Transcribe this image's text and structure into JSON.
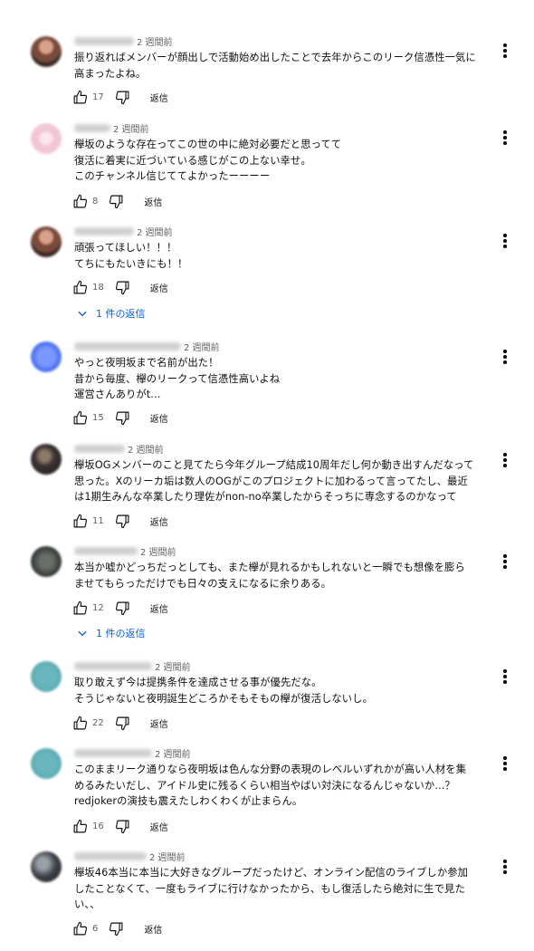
{
  "comments": [
    {
      "avatar": "av-brown",
      "time": "2 週間前",
      "text": "振り返ればメンバーが顔出しで活動始め出したことで去年からこのリーク信憑性一気に\n高まったよね。",
      "likes": "17",
      "reply_label": "返信",
      "replies": ""
    },
    {
      "avatar": "av-pink",
      "time": "2 週間前",
      "text": "欅坂のような存在ってこの世の中に絶対必要だと思ってて\n復活に着実に近づいている感じがこの上ない幸せ。\nこのチャンネル信じててよかったーーーー",
      "likes": "8",
      "reply_label": "返信",
      "replies": ""
    },
    {
      "avatar": "av-brown",
      "time": "2 週間前",
      "text": "頑張ってほしい！！！\nてちにもたいきにも！！",
      "likes": "18",
      "reply_label": "返信",
      "replies": "1 件の返信"
    },
    {
      "avatar": "av-blue",
      "time": "2 週間前",
      "text": "やっと夜明坂まで名前が出た！\n昔から毎度、欅のリークって信憑性高いよね\n運営さんありがt...",
      "likes": "15",
      "reply_label": "返信",
      "replies": ""
    },
    {
      "avatar": "av-dark",
      "time": "2 週間前",
      "text": "欅坂OGメンバーのこと見てたら今年グループ結成10周年だし何か動き出すんだなって\n思った。Xのリーカ垢は数人のOGがこのプロジェクトに加わるって言ってたし、最近\nは1期生みんな卒業したり理佐がnon-no卒業したからそっちに専念するのかなって",
      "likes": "11",
      "reply_label": "返信",
      "replies": ""
    },
    {
      "avatar": "av-grey",
      "time": "2 週間前",
      "text": "本当か嘘かどっちだっとしても、また欅が見れるかもしれないと一瞬でも想像を膨ら\nませてもらっただけでも日々の支えになるに余りある。",
      "likes": "12",
      "reply_label": "返信",
      "replies": "1 件の返信"
    },
    {
      "avatar": "av-teal",
      "time": "2 週間前",
      "text": "取り敢えず今は提携条件を達成させる事が優先だな。\nそうじゃないと夜明誕生どころかそもそもの欅が復活しないし。",
      "likes": "22",
      "reply_label": "返信",
      "replies": ""
    },
    {
      "avatar": "av-teal",
      "time": "2 週間前",
      "text": "このままリーク通りなら夜明坂は色んな分野の表現のレベルいずれかが高い人材を集\nめるみたいだし、アイドル史に残るくらい相当やばい対決になるんじゃないか...？\nredjokerの演技も震えたしわくわくが止まらん。",
      "likes": "16",
      "reply_label": "返信",
      "replies": ""
    },
    {
      "avatar": "av-mix",
      "time": "2 週間前",
      "text": "欅坂46本当に本当に大好きなグループだったけど、オンライン配信のライブしか参加\nしたことなくて、一度もライブに行けなかったから、もし復活したら絶対に生で見た\nい、、",
      "likes": "6",
      "reply_label": "返信",
      "replies": ""
    }
  ]
}
